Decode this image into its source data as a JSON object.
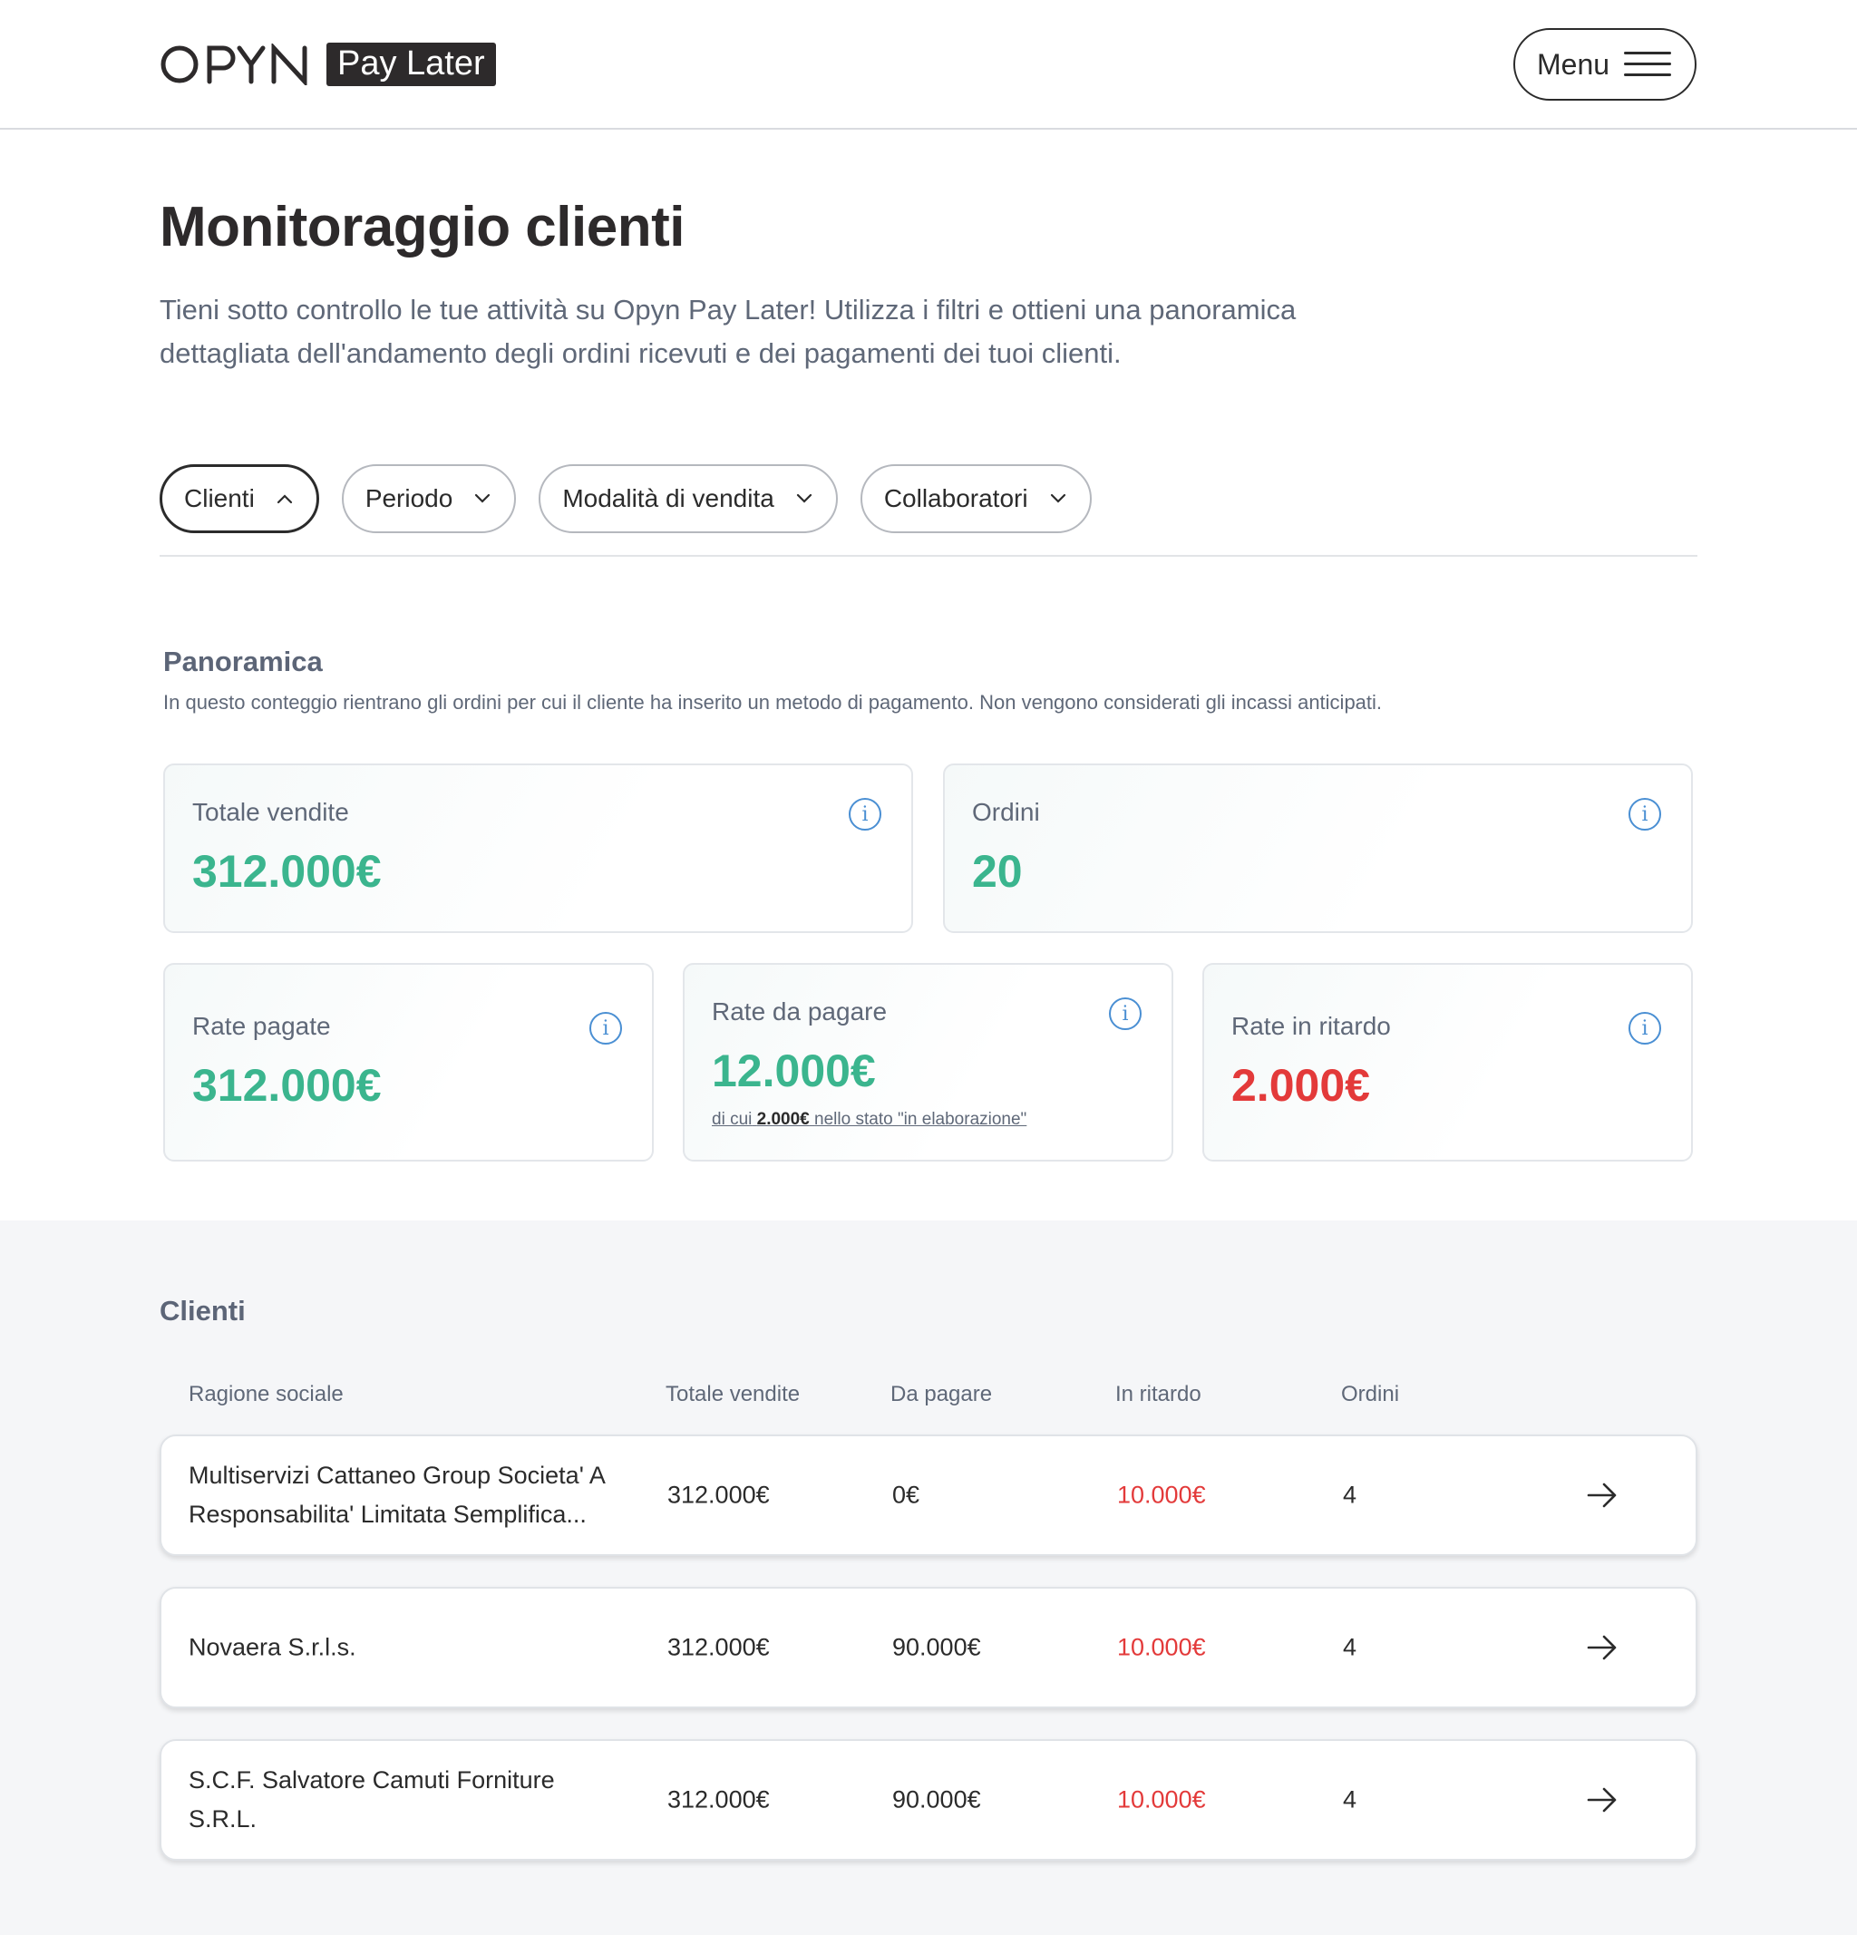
{
  "header": {
    "brand_badge": "Pay Later",
    "menu_label": "Menu"
  },
  "page": {
    "title": "Monitoraggio clienti",
    "description": "Tieni sotto controllo le tue attività su Opyn Pay Later! Utilizza i filtri e ottieni una panoramica dettagliata dell'andamento degli ordini ricevuti e dei pagamenti dei tuoi clienti."
  },
  "filters": [
    {
      "label": "Clienti",
      "state": "open"
    },
    {
      "label": "Periodo",
      "state": "closed"
    },
    {
      "label": "Modalità di vendita",
      "state": "closed"
    },
    {
      "label": "Collaboratori",
      "state": "closed"
    }
  ],
  "overview": {
    "title": "Panoramica",
    "description": "In questo conteggio rientrano gli ordini per cui il cliente ha inserito un metodo di pagamento. Non vengono considerati gli incassi anticipati.",
    "cards": {
      "totale_vendite": {
        "label": "Totale vendite",
        "value": "312.000€"
      },
      "ordini": {
        "label": "Ordini",
        "value": "20"
      },
      "rate_pagate": {
        "label": "Rate pagate",
        "value": "312.000€"
      },
      "rate_da_pagare": {
        "label": "Rate da pagare",
        "value": "12.000€",
        "note_prefix": "di cui",
        "note_amount": "2.000€",
        "note_suffix": "nello stato \"in elaborazione\""
      },
      "rate_in_ritardo": {
        "label": "Rate in ritardo",
        "value": "2.000€"
      }
    }
  },
  "clients": {
    "title": "Clienti",
    "columns": [
      "Ragione sociale",
      "Totale vendite",
      "Da pagare",
      "In ritardo",
      "Ordini"
    ],
    "rows": [
      {
        "name": "Multiservizi Cattaneo Group Societa' A Responsabilita' Limitata Semplifica...",
        "totale": "312.000€",
        "da_pagare": "0€",
        "ritardo": "10.000€",
        "ordini": "4"
      },
      {
        "name": "Novaera S.r.l.s.",
        "totale": "312.000€",
        "da_pagare": "90.000€",
        "ritardo": "10.000€",
        "ordini": "4"
      },
      {
        "name": "S.C.F. Salvatore Camuti Forniture S.R.L.",
        "totale": "312.000€",
        "da_pagare": "90.000€",
        "ritardo": "10.000€",
        "ordini": "4"
      }
    ]
  },
  "colors": {
    "positive": "#3bb58e",
    "negative": "#e33a3a",
    "info": "#4a8fd3",
    "dark": "#2d2a2b"
  }
}
